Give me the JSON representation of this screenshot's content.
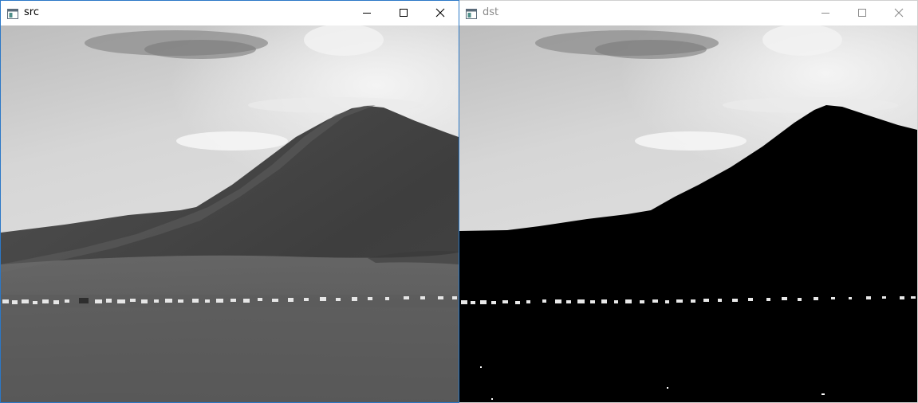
{
  "windows": {
    "src": {
      "title": "src",
      "icons": {
        "app": "app-icon",
        "minimize": "minimize-icon",
        "maximize": "maximize-icon",
        "close": "close-icon"
      },
      "active": true
    },
    "dst": {
      "title": "dst",
      "icons": {
        "app": "app-icon",
        "minimize": "minimize-icon",
        "maximize": "maximize-icon",
        "close": "close-icon"
      },
      "active": false
    }
  },
  "colors": {
    "active_border": "#2b78c7",
    "inactive_title": "#8a8a8a",
    "threshold_black": "#000000"
  }
}
